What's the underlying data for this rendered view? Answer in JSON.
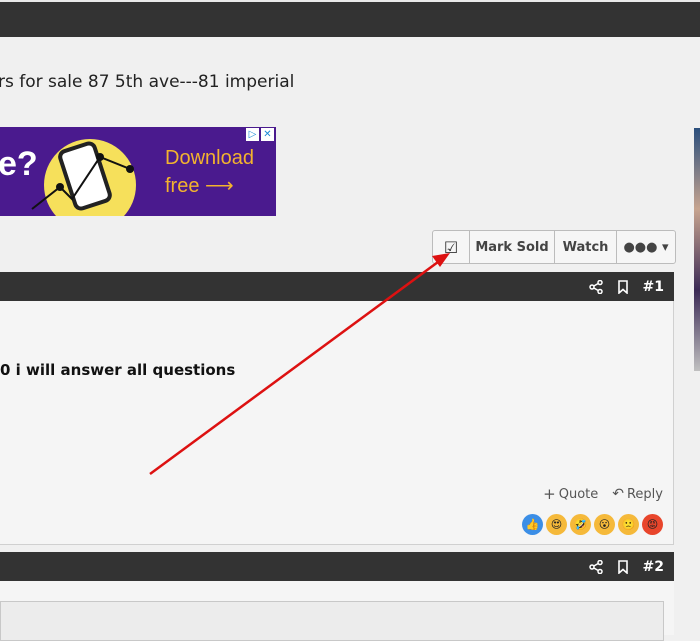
{
  "thread": {
    "title": "rs for sale 87 5th ave---81 imperial"
  },
  "ad": {
    "question_fragment": "e?",
    "line1": "Download",
    "line2": "free ⟶",
    "badge_play": "▷",
    "badge_close": "✕"
  },
  "toolbar": {
    "checkbox_icon": "☑",
    "mark_sold_label": "Mark Sold",
    "watch_label": "Watch",
    "more_label": "●●● ▾"
  },
  "posts": [
    {
      "number": "#1",
      "text": "0 i will answer all questions",
      "quote_label": "Quote",
      "reply_label": "Reply",
      "quote_icon": "+",
      "reply_icon": "↶"
    },
    {
      "number": "#2"
    }
  ],
  "reactions": [
    {
      "name": "like-icon",
      "glyph": "👍",
      "color": "#3b8ee6"
    },
    {
      "name": "love-icon",
      "glyph": "😍",
      "color": "#f5b93a"
    },
    {
      "name": "haha-icon",
      "glyph": "🤣",
      "color": "#f5b93a"
    },
    {
      "name": "wow-icon",
      "glyph": "😮",
      "color": "#f5b93a"
    },
    {
      "name": "sad-icon",
      "glyph": "🙁",
      "color": "#f5b93a"
    },
    {
      "name": "angry-icon",
      "glyph": "😡",
      "color": "#e8452b"
    }
  ],
  "colors": {
    "header_bar": "#333333",
    "ad_background": "#4a1a8e",
    "ad_text": "#f3b32e",
    "annotation_arrow": "#dd1111"
  }
}
